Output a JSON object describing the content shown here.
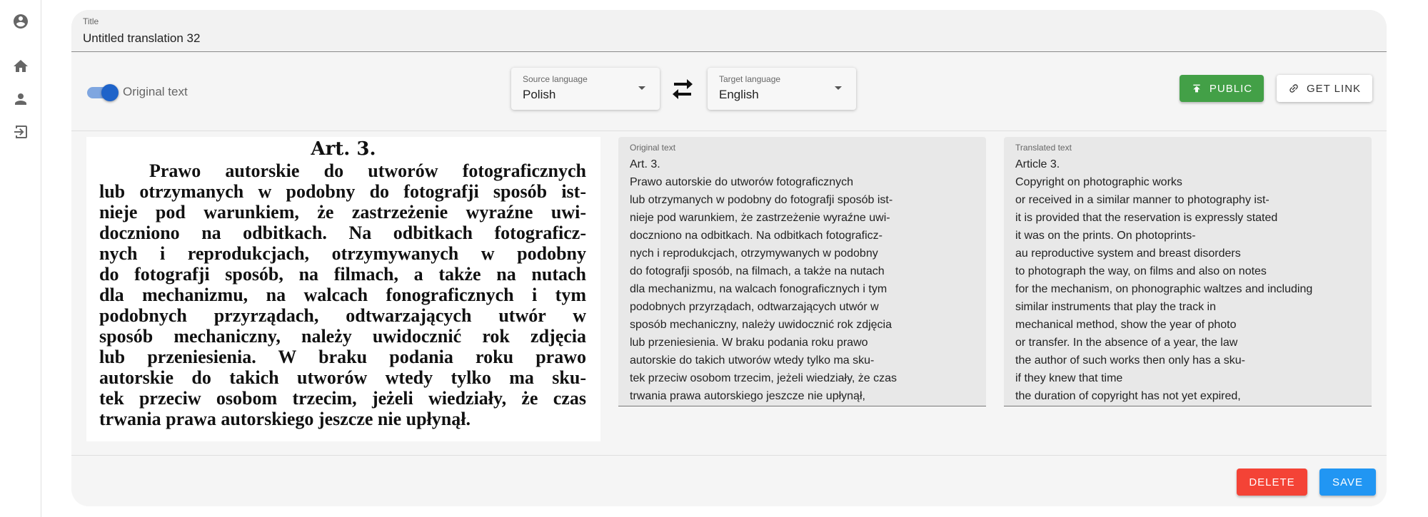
{
  "nav": {
    "items": [
      {
        "icon": "account-circle-icon"
      },
      {
        "icon": "home-icon"
      },
      {
        "icon": "person-icon"
      },
      {
        "icon": "logout-icon"
      }
    ]
  },
  "title_field": {
    "label": "Title",
    "value": "Untitled translation 32"
  },
  "toolbar": {
    "toggle_label": "Original text",
    "toggle_on": true,
    "source_language": {
      "label": "Source language",
      "value": "Polish"
    },
    "target_language": {
      "label": "Target language",
      "value": "English"
    },
    "public_label": "PUBLIC",
    "get_link_label": "GET LINK"
  },
  "scan": {
    "title": "Art. 3.",
    "lines": [
      "Prawo autorskie do utworów  fotograficznych",
      "lub otrzymanych w podobny do fotografji sposób ist-",
      "nieje pod warunkiem, że zastrzeżenie wyraźne uwi-",
      "doczniono na odbitkach.  Na odbitkach fotograficz-",
      "nych i reprodukcjach, otrzymywanych w podobny",
      "do fotografji sposób, na filmach, a także na nutach",
      "dla mechanizmu, na walcach fonograficznych i tym",
      "podobnych przyrządach,  odtwarzających  utwór w",
      "sposób mechaniczny, należy uwidocznić rok zdjęcia",
      "lub przeniesienia.   W braku podania roku prawo",
      "autorskie do takich utworów wtedy tylko ma sku-",
      "tek przeciw osobom trzecim, jeżeli wiedziały, że czas",
      "trwania prawa autorskiego jeszcze nie upłynął."
    ]
  },
  "original_panel": {
    "label": "Original text",
    "lines": [
      "Art. 3.",
      "Prawo autorskie do utworów fotograficznych",
      "lub otrzymanych w podobny do fotografji sposób ist-",
      "nieje pod warunkiem, że zastrzeżenie wyraźne uwi-",
      "doczniono na odbitkach. Na odbitkach fotograficz-",
      "nych i reprodukcjach, otrzymywanych w podobny",
      "do fotografji sposób, na filmach, a także na nutach",
      "dla mechanizmu, na walcach fonograficznych i tym",
      "podobnych przyrządach, odtwarzających utwór w",
      "sposób mechaniczny, należy uwidocznić rok zdjęcia",
      "lub przeniesienia. W braku podania roku prawo",
      "autorskie do takich utworów wtedy tylko ma sku-",
      "tek przeciw osobom trzecim, jeżeli wiedziały, że czas",
      "trwania prawa autorskiego jeszcze nie upłynął,"
    ]
  },
  "translated_panel": {
    "label": "Translated text",
    "lines": [
      "Article 3.",
      "Copyright on photographic works",
      "or received in a similar manner to photography ist-",
      "it is provided that the reservation is expressly stated",
      "it was on the prints. On photoprints-",
      "au reproductive system and breast disorders",
      "to photograph the way, on films and also on notes",
      "for the mechanism, on phonographic waltzes and including",
      "similar instruments that play the track in",
      "mechanical method, show the year of photo",
      "or transfer. In the absence of a year, the law",
      "the author of such works then only has a sku-",
      "if they knew that time",
      "the duration of copyright has not yet expired,"
    ]
  },
  "footer": {
    "delete_label": "DELETE",
    "save_label": "SAVE"
  },
  "colors": {
    "public": "#43a047",
    "delete": "#f44336",
    "save": "#2196f3",
    "toggle": "#1e63c9"
  }
}
